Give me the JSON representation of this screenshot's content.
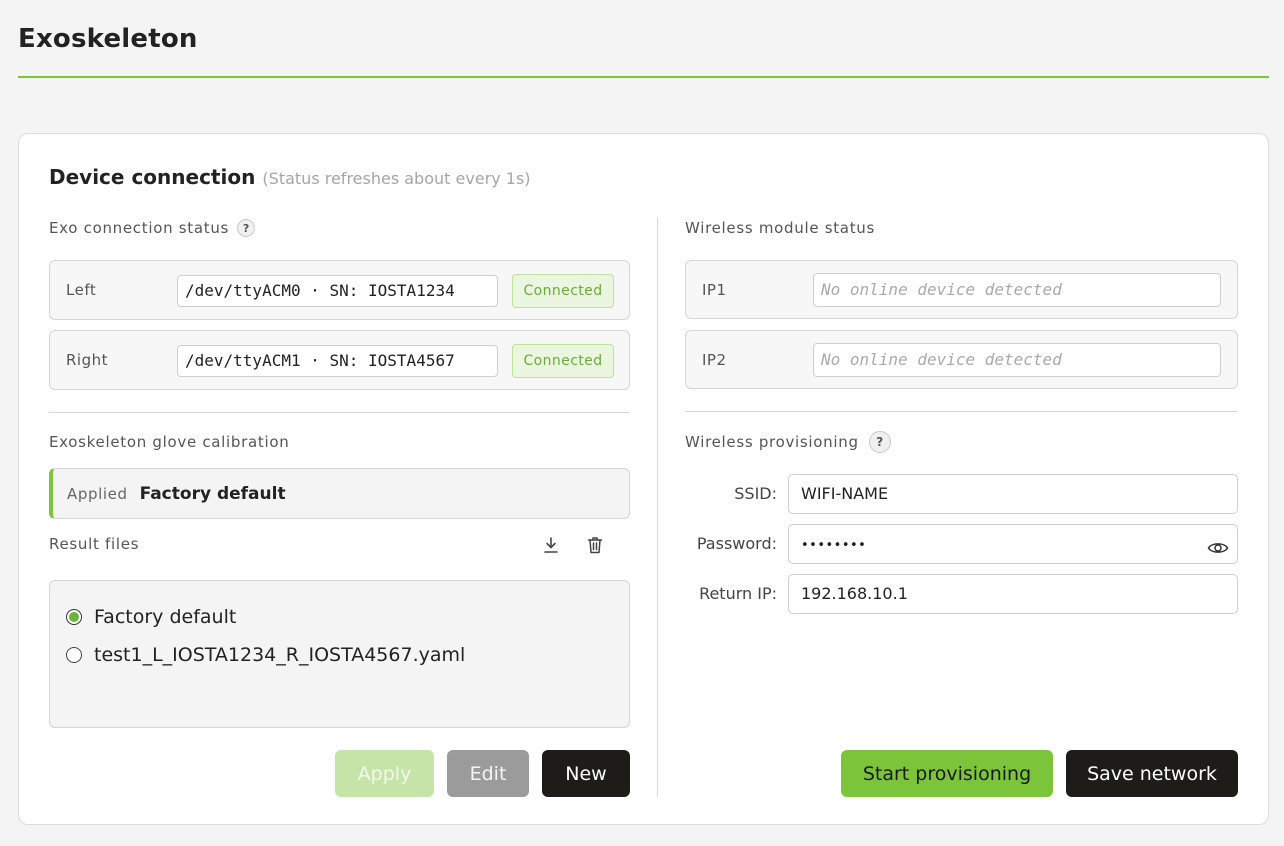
{
  "app": {
    "title": "Exoskeleton"
  },
  "device_connection": {
    "title": "Device connection",
    "subtitle": "(Status refreshes about every 1s)",
    "exo_status": {
      "label": "Exo connection status",
      "help": "?",
      "rows": [
        {
          "label": "Left",
          "value": "/dev/ttyACM0 · SN: IOSTA1234",
          "status": "Connected"
        },
        {
          "label": "Right",
          "value": "/dev/ttyACM1 · SN: IOSTA4567",
          "status": "Connected"
        }
      ]
    },
    "calibration": {
      "label": "Exoskeleton glove calibration",
      "applied_label": "Applied",
      "applied_value": "Factory default",
      "result_files_label": "Result files",
      "download_icon": "download-icon",
      "delete_icon": "trash-icon",
      "files": [
        {
          "name": "Factory default",
          "selected": true
        },
        {
          "name": "test1_L_IOSTA1234_R_IOSTA4567.yaml",
          "selected": false
        }
      ],
      "buttons": {
        "apply": "Apply",
        "edit": "Edit",
        "new": "New"
      }
    },
    "wireless_status": {
      "label": "Wireless module status",
      "rows": [
        {
          "label": "IP1",
          "placeholder": "No online device detected"
        },
        {
          "label": "IP2",
          "placeholder": "No online device detected"
        }
      ]
    },
    "provisioning": {
      "label": "Wireless provisioning",
      "help": "?",
      "ssid_label": "SSID:",
      "ssid_value": "WIFI-NAME",
      "password_label": "Password:",
      "password_value": "••••••••",
      "password_toggle_icon": "eye-icon",
      "return_ip_label": "Return IP:",
      "return_ip_value": "192.168.10.1",
      "buttons": {
        "start": "Start provisioning",
        "save": "Save network"
      }
    }
  },
  "colors": {
    "accent": "#7cc53a",
    "dark_button": "#1e1c19",
    "connected_text": "#6cab3a",
    "connected_bg": "#eaf6df"
  }
}
